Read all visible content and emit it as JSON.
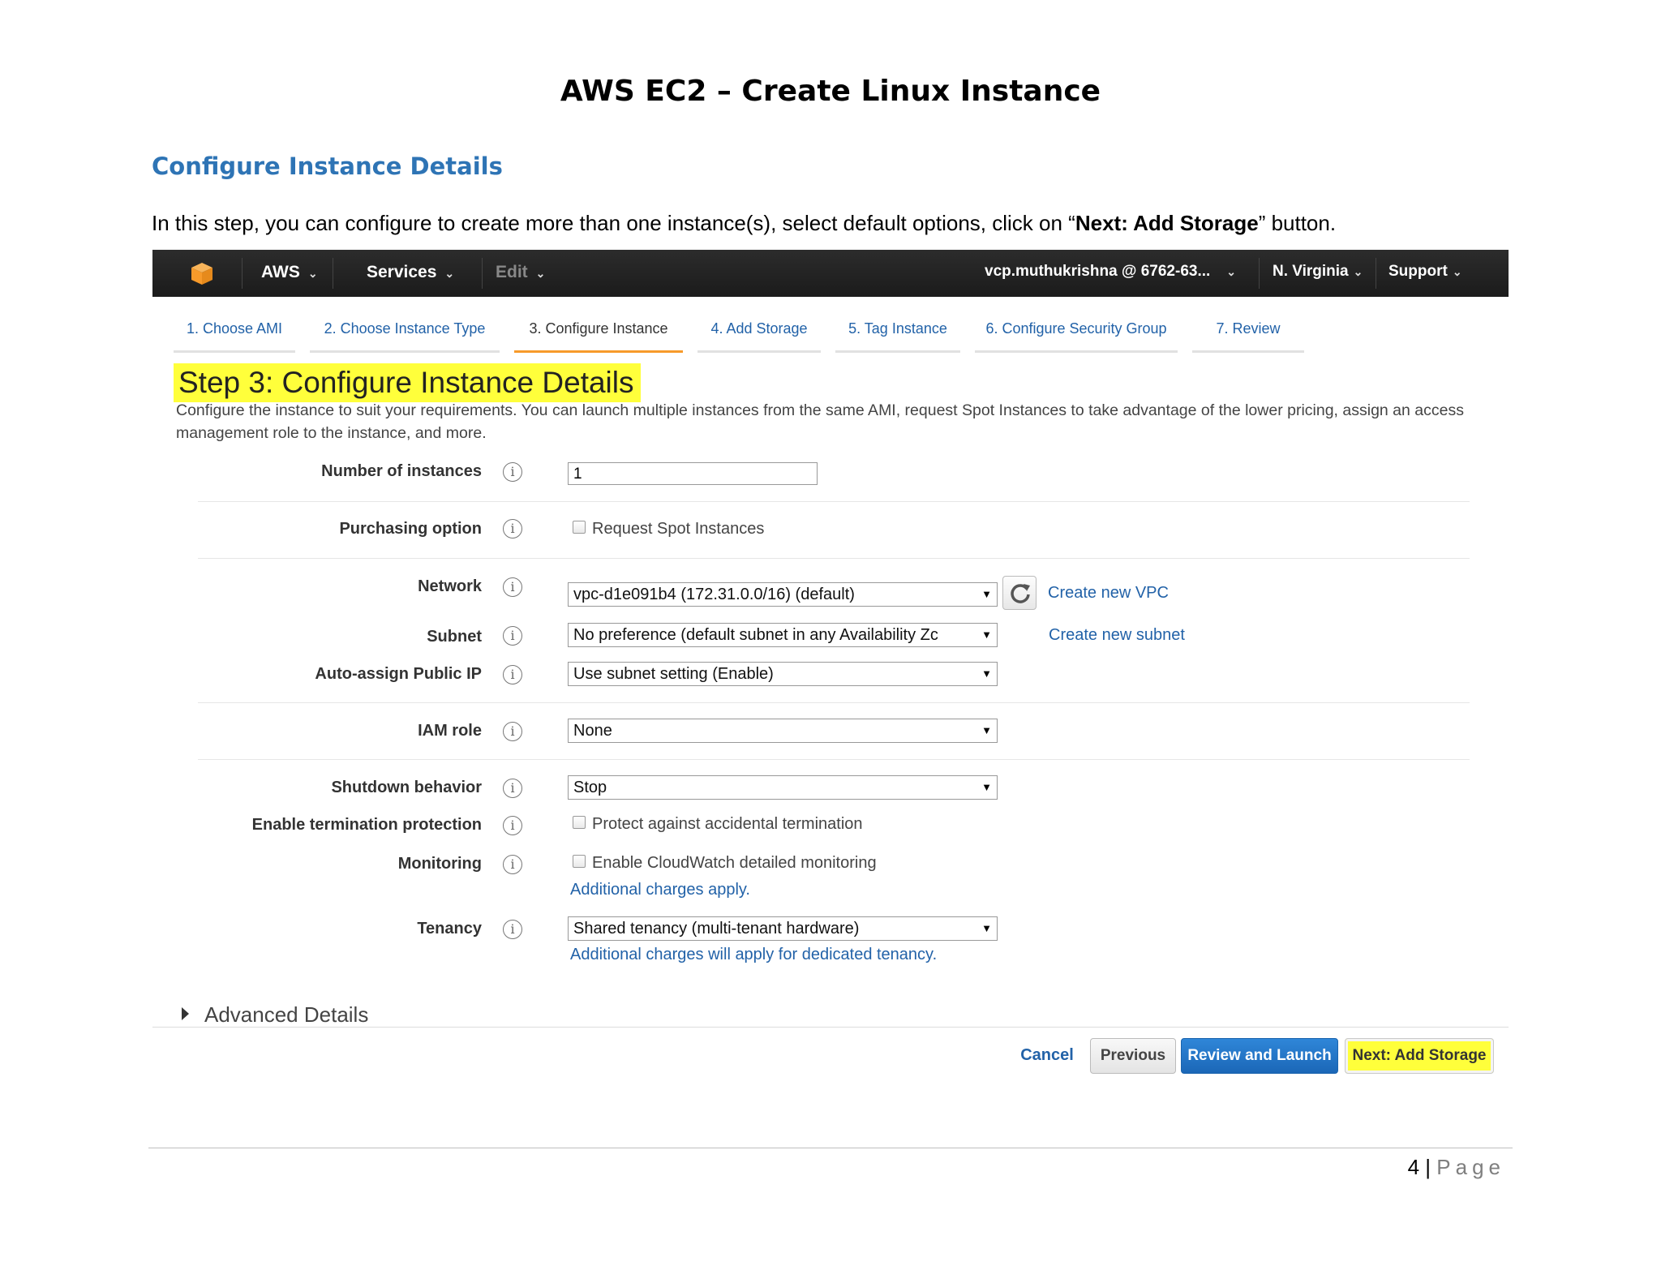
{
  "document": {
    "title": "AWS EC2 – Create Linux Instance",
    "heading": "Configure Instance Details",
    "para_before": "In this step, you can configure to create more than one instance(s), select default options, click on “",
    "para_bold": "Next: Add Storage",
    "para_after": "” button.",
    "page_number": "4",
    "page_sep": " | ",
    "page_word": "Page"
  },
  "topbar": {
    "aws_label": "AWS",
    "services_label": "Services",
    "edit_label": "Edit",
    "account": "vcp.muthukrishna @ 6762-63...",
    "region": "N. Virginia",
    "support": "Support",
    "caret": "⌄"
  },
  "steps": [
    {
      "label": "1. Choose AMI"
    },
    {
      "label": "2. Choose Instance Type"
    },
    {
      "label": "3. Configure Instance"
    },
    {
      "label": "4. Add Storage"
    },
    {
      "label": "5. Tag Instance"
    },
    {
      "label": "6. Configure Security Group"
    },
    {
      "label": "7. Review"
    }
  ],
  "form": {
    "title": "Step 3: Configure Instance Details",
    "description": "Configure the instance to suit your requirements. You can launch multiple instances from the same AMI, request Spot Instances to take advantage of the lower pricing, assign an access management role to the instance, and more.",
    "info_glyph": "i",
    "number_of_instances": {
      "label": "Number of instances",
      "value": "1"
    },
    "purchasing_option": {
      "label": "Purchasing option",
      "checkbox_label": "Request Spot Instances"
    },
    "network": {
      "label": "Network",
      "value": "vpc-d1e091b4 (172.31.0.0/16) (default)",
      "link": "Create new VPC"
    },
    "subnet": {
      "label": "Subnet",
      "value": "No preference (default subnet in any Availability Zc",
      "link": "Create new subnet"
    },
    "auto_assign_ip": {
      "label": "Auto-assign Public IP",
      "value": "Use subnet setting (Enable)"
    },
    "iam_role": {
      "label": "IAM role",
      "value": "None"
    },
    "shutdown_behavior": {
      "label": "Shutdown behavior",
      "value": "Stop"
    },
    "termination_protection": {
      "label": "Enable termination protection",
      "checkbox_label": "Protect against accidental termination"
    },
    "monitoring": {
      "label": "Monitoring",
      "checkbox_label": "Enable CloudWatch detailed monitoring",
      "note": "Additional charges apply."
    },
    "tenancy": {
      "label": "Tenancy",
      "value": "Shared tenancy (multi-tenant hardware)",
      "note": "Additional charges will apply for dedicated tenancy."
    },
    "advanced_details": "Advanced Details",
    "dropdown_arrow": "▼"
  },
  "buttons": {
    "cancel": "Cancel",
    "previous": "Previous",
    "review_launch": "Review and Launch",
    "next": "Next: Add Storage"
  },
  "colors": {
    "topbar_bg": "#1f1f1f",
    "link_blue": "#2262a8",
    "heading_blue": "#2e74b5",
    "highlight_yellow": "#ffff3b",
    "primary_button": "#1b67b7",
    "active_step_underline": "#f79a2a",
    "aws_cube": "#f79a2a"
  }
}
